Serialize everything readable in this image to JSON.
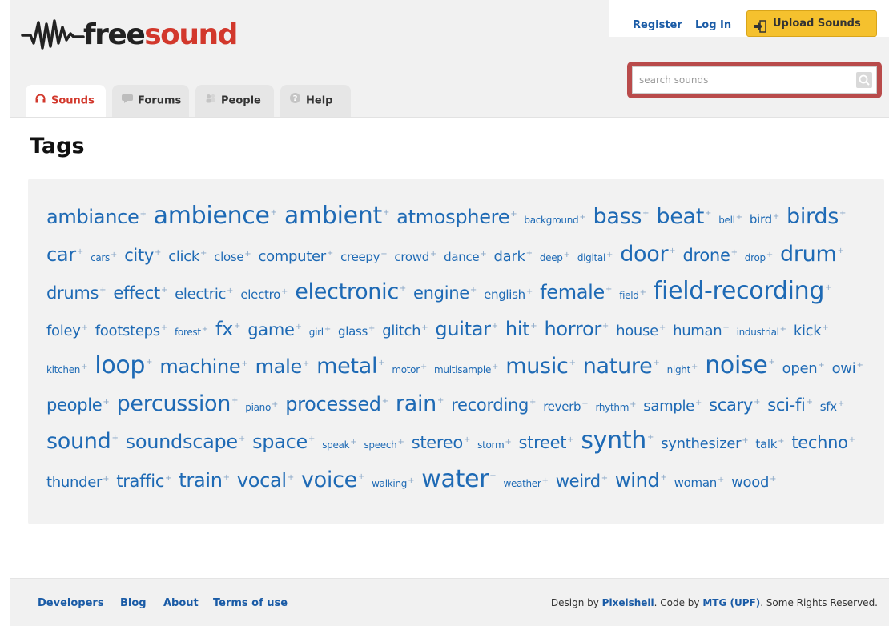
{
  "header": {
    "logo_free": "free",
    "logo_sound": "sound",
    "tabs": [
      {
        "label": "Sounds",
        "icon": "headphones-icon"
      },
      {
        "label": "Forums",
        "icon": "speech-bubble-icon"
      },
      {
        "label": "People",
        "icon": "people-icon"
      },
      {
        "label": "Help",
        "icon": "help-icon"
      }
    ],
    "register": "Register",
    "login": "Log In",
    "upload": "Upload Sounds",
    "search_placeholder": "search sounds"
  },
  "page": {
    "title": "Tags"
  },
  "tags": [
    {
      "name": "ambiance",
      "size": 5
    },
    {
      "name": "ambience",
      "size": 7
    },
    {
      "name": "ambient",
      "size": 7
    },
    {
      "name": "atmosphere",
      "size": 5
    },
    {
      "name": "background",
      "size": 1
    },
    {
      "name": "bass",
      "size": 6
    },
    {
      "name": "beat",
      "size": 6
    },
    {
      "name": "bell",
      "size": 1
    },
    {
      "name": "bird",
      "size": 2
    },
    {
      "name": "birds",
      "size": 6
    },
    {
      "name": "car",
      "size": 5
    },
    {
      "name": "cars",
      "size": 1
    },
    {
      "name": "city",
      "size": 4
    },
    {
      "name": "click",
      "size": 3
    },
    {
      "name": "close",
      "size": 2
    },
    {
      "name": "computer",
      "size": 3
    },
    {
      "name": "creepy",
      "size": 2
    },
    {
      "name": "crowd",
      "size": 2
    },
    {
      "name": "dance",
      "size": 2
    },
    {
      "name": "dark",
      "size": 3
    },
    {
      "name": "deep",
      "size": 1
    },
    {
      "name": "digital",
      "size": 1
    },
    {
      "name": "door",
      "size": 6
    },
    {
      "name": "drone",
      "size": 4
    },
    {
      "name": "drop",
      "size": 1
    },
    {
      "name": "drum",
      "size": 6
    },
    {
      "name": "drums",
      "size": 4
    },
    {
      "name": "effect",
      "size": 4
    },
    {
      "name": "electric",
      "size": 3
    },
    {
      "name": "electro",
      "size": 2
    },
    {
      "name": "electronic",
      "size": 6
    },
    {
      "name": "engine",
      "size": 4
    },
    {
      "name": "english",
      "size": 2
    },
    {
      "name": "female",
      "size": 5
    },
    {
      "name": "field",
      "size": 1
    },
    {
      "name": "field-recording",
      "size": 7
    },
    {
      "name": "foley",
      "size": 3
    },
    {
      "name": "footsteps",
      "size": 3
    },
    {
      "name": "forest",
      "size": 1
    },
    {
      "name": "fx",
      "size": 5
    },
    {
      "name": "game",
      "size": 4
    },
    {
      "name": "girl",
      "size": 1
    },
    {
      "name": "glass",
      "size": 2
    },
    {
      "name": "glitch",
      "size": 3
    },
    {
      "name": "guitar",
      "size": 5
    },
    {
      "name": "hit",
      "size": 5
    },
    {
      "name": "horror",
      "size": 5
    },
    {
      "name": "house",
      "size": 3
    },
    {
      "name": "human",
      "size": 3
    },
    {
      "name": "industrial",
      "size": 1
    },
    {
      "name": "kick",
      "size": 3
    },
    {
      "name": "kitchen",
      "size": 1
    },
    {
      "name": "loop",
      "size": 7
    },
    {
      "name": "machine",
      "size": 5
    },
    {
      "name": "male",
      "size": 5
    },
    {
      "name": "metal",
      "size": 6
    },
    {
      "name": "motor",
      "size": 1
    },
    {
      "name": "multisample",
      "size": 1
    },
    {
      "name": "music",
      "size": 6
    },
    {
      "name": "nature",
      "size": 6
    },
    {
      "name": "night",
      "size": 1
    },
    {
      "name": "noise",
      "size": 7
    },
    {
      "name": "open",
      "size": 3
    },
    {
      "name": "owi",
      "size": 3
    },
    {
      "name": "people",
      "size": 4
    },
    {
      "name": "percussion",
      "size": 6
    },
    {
      "name": "piano",
      "size": 1
    },
    {
      "name": "processed",
      "size": 5
    },
    {
      "name": "rain",
      "size": 6
    },
    {
      "name": "recording",
      "size": 4
    },
    {
      "name": "reverb",
      "size": 2
    },
    {
      "name": "rhythm",
      "size": 1
    },
    {
      "name": "sample",
      "size": 3
    },
    {
      "name": "scary",
      "size": 4
    },
    {
      "name": "sci-fi",
      "size": 4
    },
    {
      "name": "sfx",
      "size": 2
    },
    {
      "name": "sound",
      "size": 6
    },
    {
      "name": "soundscape",
      "size": 5
    },
    {
      "name": "space",
      "size": 5
    },
    {
      "name": "speak",
      "size": 1
    },
    {
      "name": "speech",
      "size": 1
    },
    {
      "name": "stereo",
      "size": 4
    },
    {
      "name": "storm",
      "size": 1
    },
    {
      "name": "street",
      "size": 4
    },
    {
      "name": "synth",
      "size": 7
    },
    {
      "name": "synthesizer",
      "size": 3
    },
    {
      "name": "talk",
      "size": 2
    },
    {
      "name": "techno",
      "size": 4
    },
    {
      "name": "thunder",
      "size": 3
    },
    {
      "name": "traffic",
      "size": 4
    },
    {
      "name": "train",
      "size": 5
    },
    {
      "name": "vocal",
      "size": 5
    },
    {
      "name": "voice",
      "size": 6
    },
    {
      "name": "walking",
      "size": 1
    },
    {
      "name": "water",
      "size": 7
    },
    {
      "name": "weather",
      "size": 1
    },
    {
      "name": "weird",
      "size": 4
    },
    {
      "name": "wind",
      "size": 5
    },
    {
      "name": "woman",
      "size": 2
    },
    {
      "name": "wood",
      "size": 3
    }
  ],
  "footer": {
    "links": [
      "Developers",
      "Blog",
      "About",
      "Terms of use"
    ],
    "credit_design": "Design by ",
    "credit_pixelshell": "Pixelshell",
    "credit_code": ". Code by ",
    "credit_mtg": "MTG (UPF)",
    "credit_rights": ". Some Rights Reserved."
  },
  "colors": {
    "brand_red": "#d2382c",
    "link_blue": "#1a5ba6",
    "tag_blue": "#1e6ab5",
    "upload_yellow": "#f5c12e"
  }
}
